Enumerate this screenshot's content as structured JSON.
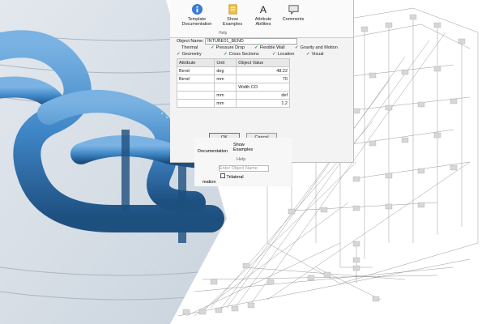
{
  "ribbon": {
    "template_documentation": "Template Documentation",
    "show_examples": "Show Examples",
    "attribute_abilities": "Attribute Abilities",
    "comments": "Comments",
    "help_group": "Help"
  },
  "object_name": {
    "label": "Object Name:",
    "value": "INTUBE01_BEND"
  },
  "tabs": {
    "thermal": "Thermal",
    "pressure_drop": "Pressure Drop",
    "flexible_wall": "Flexible Wall",
    "gravity_and_motion": "Gravity and Motion",
    "geometry": "Geometry",
    "cross_sections": "Cross Sections",
    "location": "Location",
    "visual": "Visual"
  },
  "table": {
    "headers": [
      "Attribute",
      "Unit",
      "Object Value"
    ],
    "rows": [
      {
        "attr": "Bend",
        "unit": "deg",
        "value": "48.22"
      },
      {
        "attr": "Bend",
        "unit": "mm",
        "value": "70"
      },
      {
        "attr": "",
        "unit": "",
        "value": "Width CO"
      },
      {
        "attr": "",
        "unit": "mm",
        "value": "def"
      },
      {
        "attr": "",
        "unit": "mm",
        "value": "1.2"
      }
    ]
  },
  "buttons": {
    "ok": "OK",
    "cancel": "Cancel"
  },
  "second_ribbon": {
    "template_documentation": "Documentation",
    "show_examples": "Show Examples",
    "help_group": "Help",
    "filter_placeholder": "Enter Object Name",
    "trilateral": "Trilateral",
    "information": "mation"
  },
  "colors": {
    "pipe": "#3f86c6",
    "pipe_dark": "#1d4f7f",
    "network_line": "#8a8a8a",
    "check": "#2e9d3a"
  }
}
